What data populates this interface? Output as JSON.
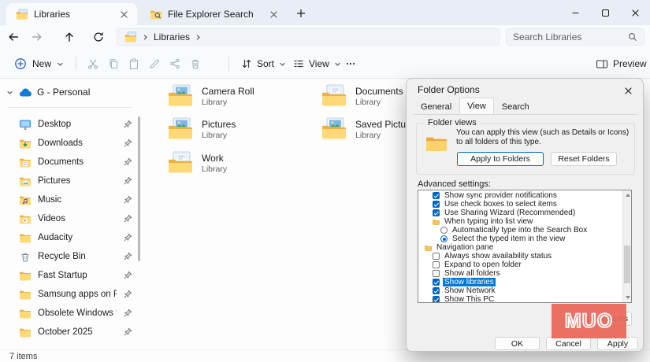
{
  "colors": {
    "accent": "#0067c0",
    "selection_blue": "#0078d7",
    "watermark_red": "#e96a5b",
    "folder_yellow": "#ffd977"
  },
  "titlebar": {
    "tabs": [
      {
        "label": "Libraries",
        "icon": "library",
        "active": true
      },
      {
        "label": "File Explorer Search",
        "icon": "folder-search",
        "active": false
      }
    ]
  },
  "navbar": {
    "buttons": [
      "back",
      "forward",
      "up",
      "refresh"
    ],
    "address": {
      "icon": "library",
      "location": "Libraries"
    },
    "search_placeholder": "Search Libraries"
  },
  "toolbar": {
    "new_label": "New",
    "actions": [
      "cut",
      "copy",
      "paste",
      "rename",
      "share",
      "delete"
    ],
    "sort_label": "Sort",
    "view_label": "View",
    "preview_label": "Preview"
  },
  "sidebar": {
    "onedrive_label": "G - Personal",
    "items": [
      {
        "label": "Desktop",
        "icon": "desktop",
        "pinned": true
      },
      {
        "label": "Downloads",
        "icon": "downloads",
        "pinned": true
      },
      {
        "label": "Documents",
        "icon": "documents",
        "pinned": true
      },
      {
        "label": "Pictures",
        "icon": "pictures",
        "pinned": true
      },
      {
        "label": "Music",
        "icon": "music",
        "pinned": true
      },
      {
        "label": "Videos",
        "icon": "videos",
        "pinned": true
      },
      {
        "label": "Audacity",
        "icon": "folder",
        "pinned": true
      },
      {
        "label": "Recycle Bin",
        "icon": "recycle-bin",
        "pinned": true
      },
      {
        "label": "Fast Startup",
        "icon": "folder",
        "pinned": true
      },
      {
        "label": "Samsung apps on PC",
        "icon": "folder",
        "pinned": true
      },
      {
        "label": "Obsolete Windows tools",
        "icon": "folder",
        "pinned": true
      },
      {
        "label": "October 2025",
        "icon": "folder",
        "pinned": true
      }
    ]
  },
  "content": {
    "items": [
      {
        "name": "Camera Roll",
        "type": "Library",
        "kind": "photos"
      },
      {
        "name": "Documents",
        "type": "Library",
        "kind": "documents"
      },
      {
        "name": "Pictures",
        "type": "Library",
        "kind": "photos"
      },
      {
        "name": "Saved Pictures",
        "type": "Library",
        "kind": "photos"
      },
      {
        "name": "Work",
        "type": "Library",
        "kind": "documents"
      }
    ]
  },
  "dialog": {
    "title": "Folder Options",
    "tabs": [
      {
        "label": "General",
        "active": false
      },
      {
        "label": "View",
        "active": true
      },
      {
        "label": "Search",
        "active": false
      }
    ],
    "folder_views": {
      "group_label": "Folder views",
      "description": "You can apply this view (such as Details or Icons) to all folders of this type.",
      "apply_button": "Apply to Folders",
      "reset_button": "Reset Folders"
    },
    "advanced_label": "Advanced settings:",
    "settings": [
      {
        "type": "checkbox",
        "checked": true,
        "indent": 1,
        "label": "Show sync provider notifications"
      },
      {
        "type": "checkbox",
        "checked": true,
        "indent": 1,
        "label": "Use check boxes to select items"
      },
      {
        "type": "checkbox",
        "checked": true,
        "indent": 1,
        "label": "Use Sharing Wizard (Recommended)"
      },
      {
        "type": "folder",
        "indent": 1,
        "label": "When typing into list view"
      },
      {
        "type": "radio",
        "checked": false,
        "indent": 2,
        "label": "Automatically type into the Search Box"
      },
      {
        "type": "radio",
        "checked": true,
        "indent": 2,
        "label": "Select the typed item in the view"
      },
      {
        "type": "folder",
        "indent": 0,
        "label": "Navigation pane"
      },
      {
        "type": "checkbox",
        "checked": false,
        "indent": 1,
        "label": "Always show availability status"
      },
      {
        "type": "checkbox",
        "checked": false,
        "indent": 1,
        "label": "Expand to open folder"
      },
      {
        "type": "checkbox",
        "checked": false,
        "indent": 1,
        "label": "Show all folders"
      },
      {
        "type": "checkbox",
        "checked": true,
        "indent": 1,
        "label": "Show libraries",
        "selected": true
      },
      {
        "type": "checkbox",
        "checked": true,
        "indent": 1,
        "label": "Show Network"
      },
      {
        "type": "checkbox",
        "checked": true,
        "indent": 1,
        "label": "Show This PC"
      }
    ],
    "restore_button": "Restore Defaults",
    "ok_button": "OK",
    "cancel_button": "Cancel",
    "apply_button": "Apply"
  },
  "statusbar": {
    "items_count": "7 items"
  },
  "watermark": {
    "text": "MUO"
  }
}
